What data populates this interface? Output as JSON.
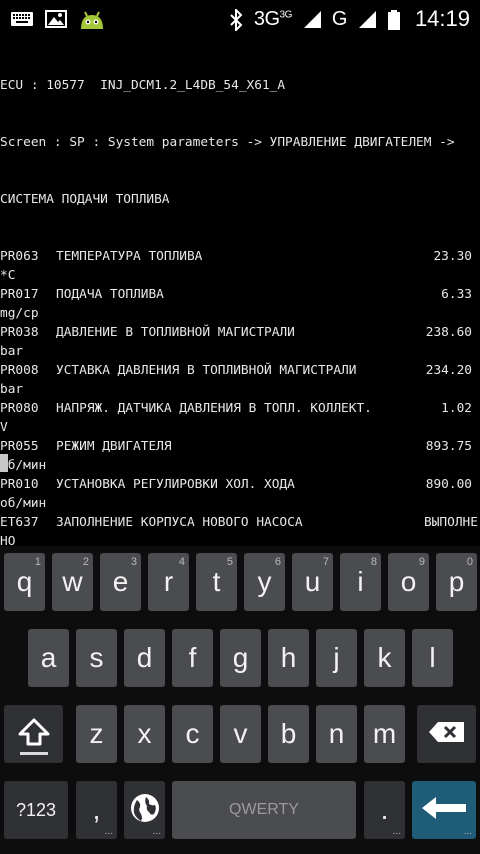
{
  "statusbar": {
    "icons_left": [
      "keyboard-icon",
      "image-icon",
      "android-icon"
    ],
    "network_3g": "3G",
    "network_3g_sup": "3G",
    "network_g": "G",
    "time": "14:19"
  },
  "terminal": {
    "header1": "ECU : 10577  INJ_DCM1.2_L4DB_54_X61_A",
    "header2": "Screen : SP : System parameters -> УПРАВЛЕНИЕ ДВИГАТЕЛЕМ ->",
    "header3": "СИСТЕМА ПОДАЧИ ТОПЛИВА",
    "params": [
      {
        "code": "PR063",
        "name": "ТЕМПЕРАТУРА ТОПЛИВА",
        "value": "23.30",
        "unit": "*C"
      },
      {
        "code": "PR017",
        "name": "ПОДАЧА ТОПЛИВА",
        "value": "6.33",
        "unit": "mg/cp"
      },
      {
        "code": "PR038",
        "name": "ДАВЛЕНИЕ В ТОПЛИВНОЙ МАГИСТРАЛИ",
        "value": "238.60",
        "unit": "bar"
      },
      {
        "code": "PR008",
        "name": "УСТАВКА ДАВЛЕНИЯ В ТОПЛИВНОЙ МАГИСТРАЛИ",
        "value": "234.20",
        "unit": "bar"
      },
      {
        "code": "PR080",
        "name": "НАПРЯЖ. ДАТЧИКА ДАВЛЕНИЯ В ТОПЛ. КОЛЛЕКТ.",
        "value": "1.02",
        "unit": "V"
      },
      {
        "code": "PR055",
        "name": "РЕЖИМ ДВИГАТЕЛЯ",
        "value": "893.75",
        "unit": "об/мин"
      },
      {
        "code": "PR010",
        "name": "УСТАНОВКА РЕГУЛИРОВКИ ХОЛ. ХОДА",
        "value": "890.00",
        "unit": "об/мин"
      },
      {
        "code": "ET637",
        "name": "ЗАПОЛНЕНИЕ КОРПУСА НОВОГО НАСОСА",
        "value": "ВЫПОЛНЕ",
        "unit": "НО"
      }
    ]
  },
  "keyboard": {
    "row1": [
      {
        "ch": "q",
        "hint": "1"
      },
      {
        "ch": "w",
        "hint": "2"
      },
      {
        "ch": "e",
        "hint": "3"
      },
      {
        "ch": "r",
        "hint": "4"
      },
      {
        "ch": "t",
        "hint": "5"
      },
      {
        "ch": "y",
        "hint": "6"
      },
      {
        "ch": "u",
        "hint": "7"
      },
      {
        "ch": "i",
        "hint": "8"
      },
      {
        "ch": "o",
        "hint": "9"
      },
      {
        "ch": "p",
        "hint": "0"
      }
    ],
    "row2": [
      "a",
      "s",
      "d",
      "f",
      "g",
      "h",
      "j",
      "k",
      "l"
    ],
    "row3": [
      "z",
      "x",
      "c",
      "v",
      "b",
      "n",
      "m"
    ],
    "symbols_label": "?123",
    "comma_label": ",",
    "space_label": "QWERTY",
    "period_label": ".",
    "more_dots": "..."
  }
}
